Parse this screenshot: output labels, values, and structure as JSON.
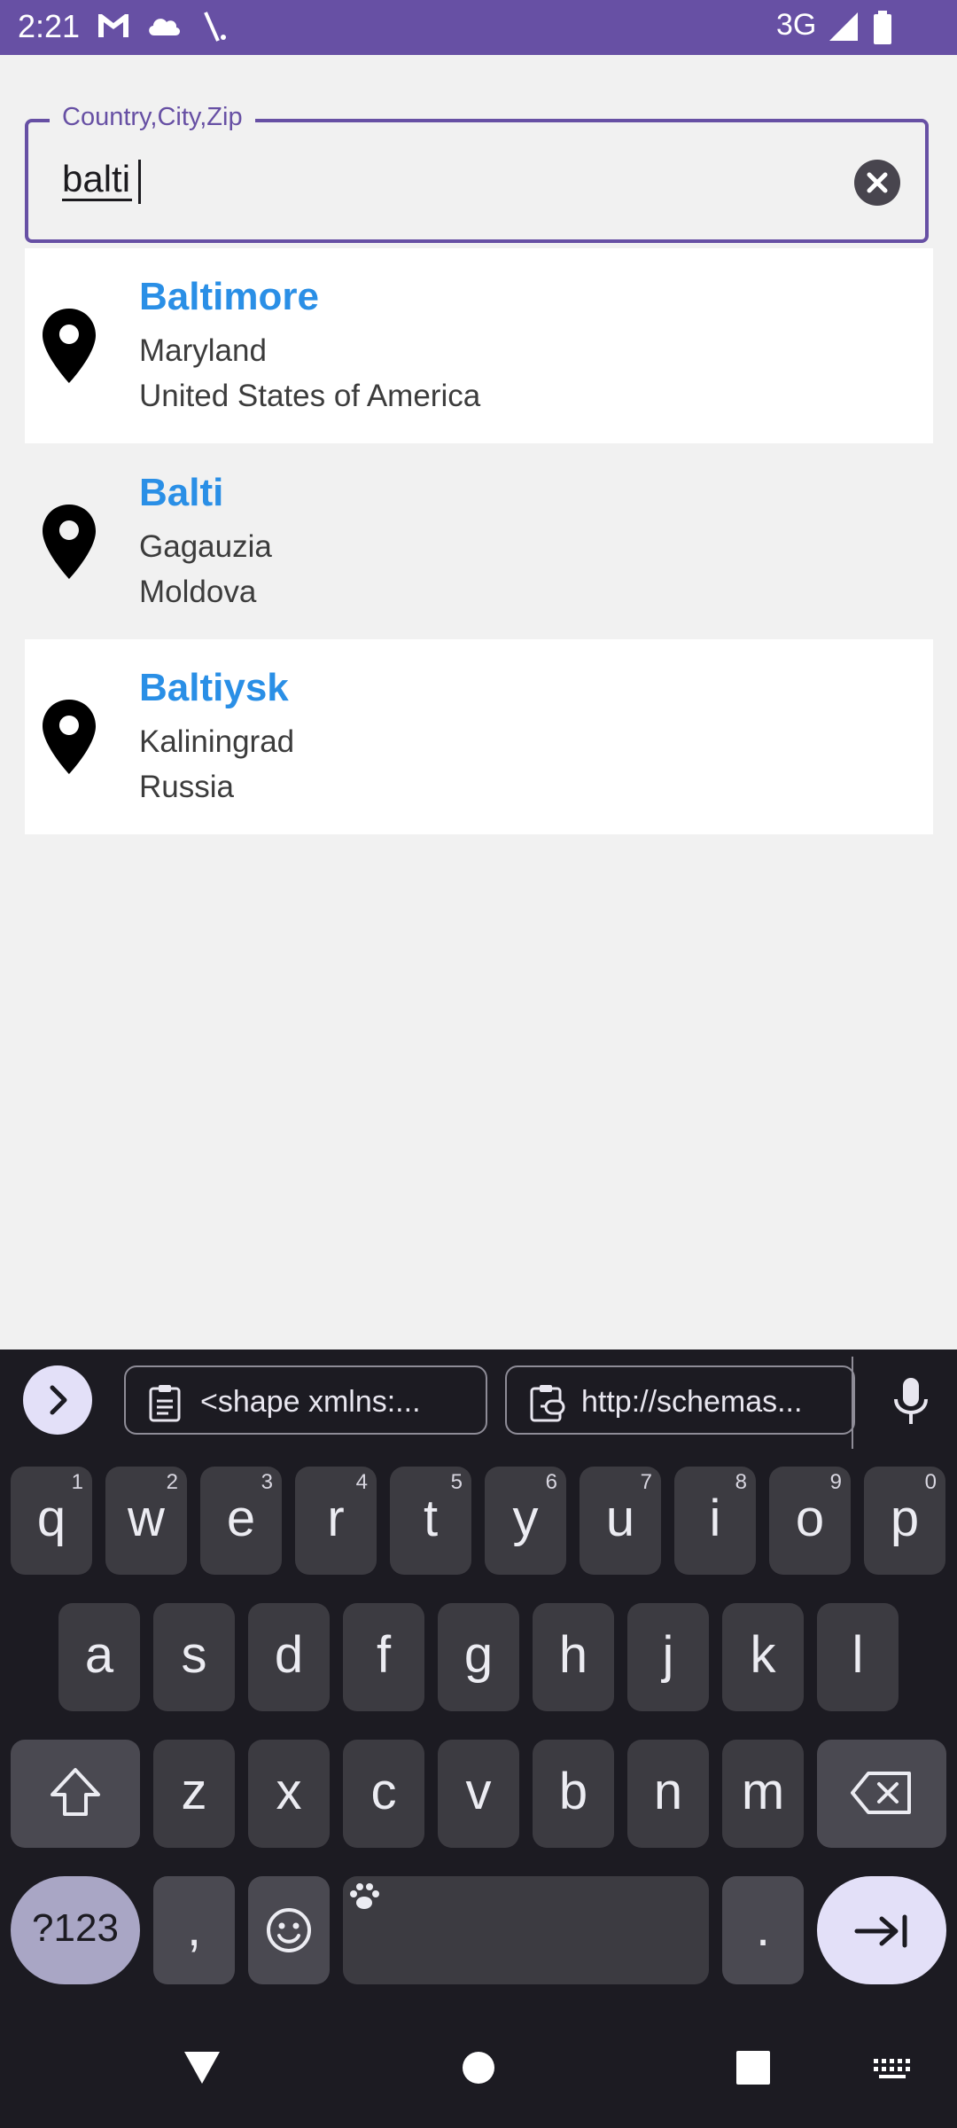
{
  "status_bar": {
    "time": "2:21",
    "network": "3G",
    "icons": [
      "gmail-icon",
      "cloud-icon",
      "sync-icon",
      "signal-icon",
      "battery-icon"
    ]
  },
  "search": {
    "label": "Country,City,Zip",
    "value": "balti",
    "accent": "#6750a4"
  },
  "results": [
    {
      "city": "Baltimore",
      "region": "Maryland",
      "country": "United States of America"
    },
    {
      "city": "Balti",
      "region": "Gagauzia",
      "country": "Moldova"
    },
    {
      "city": "Baltiysk",
      "region": "Kaliningrad",
      "country": "Russia"
    }
  ],
  "keyboard": {
    "clipboard_chips": [
      "<shape xmlns:...",
      "http://schemas..."
    ],
    "row1": [
      {
        "key": "q",
        "hint": "1"
      },
      {
        "key": "w",
        "hint": "2"
      },
      {
        "key": "e",
        "hint": "3"
      },
      {
        "key": "r",
        "hint": "4"
      },
      {
        "key": "t",
        "hint": "5"
      },
      {
        "key": "y",
        "hint": "6"
      },
      {
        "key": "u",
        "hint": "7"
      },
      {
        "key": "i",
        "hint": "8"
      },
      {
        "key": "o",
        "hint": "9"
      },
      {
        "key": "p",
        "hint": "0"
      }
    ],
    "row2": [
      "a",
      "s",
      "d",
      "f",
      "g",
      "h",
      "j",
      "k",
      "l"
    ],
    "row3": [
      "z",
      "x",
      "c",
      "v",
      "b",
      "n",
      "m"
    ],
    "symbols_label": "?123",
    "comma": ",",
    "period": "."
  },
  "colors": {
    "status_bar": "#6750a4",
    "city_text": "#2a8fe6",
    "keyboard_bg": "#1c1b22"
  }
}
